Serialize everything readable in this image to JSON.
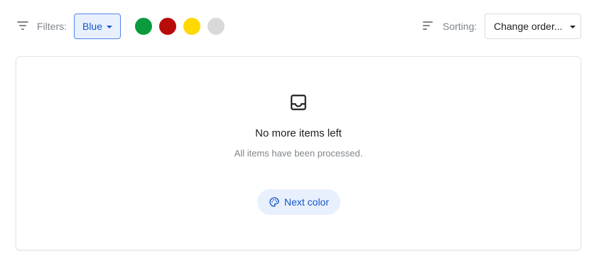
{
  "filters": {
    "label": "Filters:",
    "selected": "Blue",
    "swatches": [
      {
        "name": "green",
        "color": "#0b9a3e"
      },
      {
        "name": "red",
        "color": "#b80b0b"
      },
      {
        "name": "yellow",
        "color": "#ffd900"
      },
      {
        "name": "gray",
        "color": "#d9d9d9"
      }
    ]
  },
  "sorting": {
    "label": "Sorting:",
    "selected": "Change order..."
  },
  "empty_state": {
    "icon": "inbox-icon",
    "title": "No more items left",
    "subtitle": "All items have been processed.",
    "button_label": "Next color",
    "button_icon": "palette-icon"
  },
  "colors": {
    "accent": "#1a56c8",
    "accent_bg": "#e8f0fe",
    "muted_text": "#80868b"
  }
}
